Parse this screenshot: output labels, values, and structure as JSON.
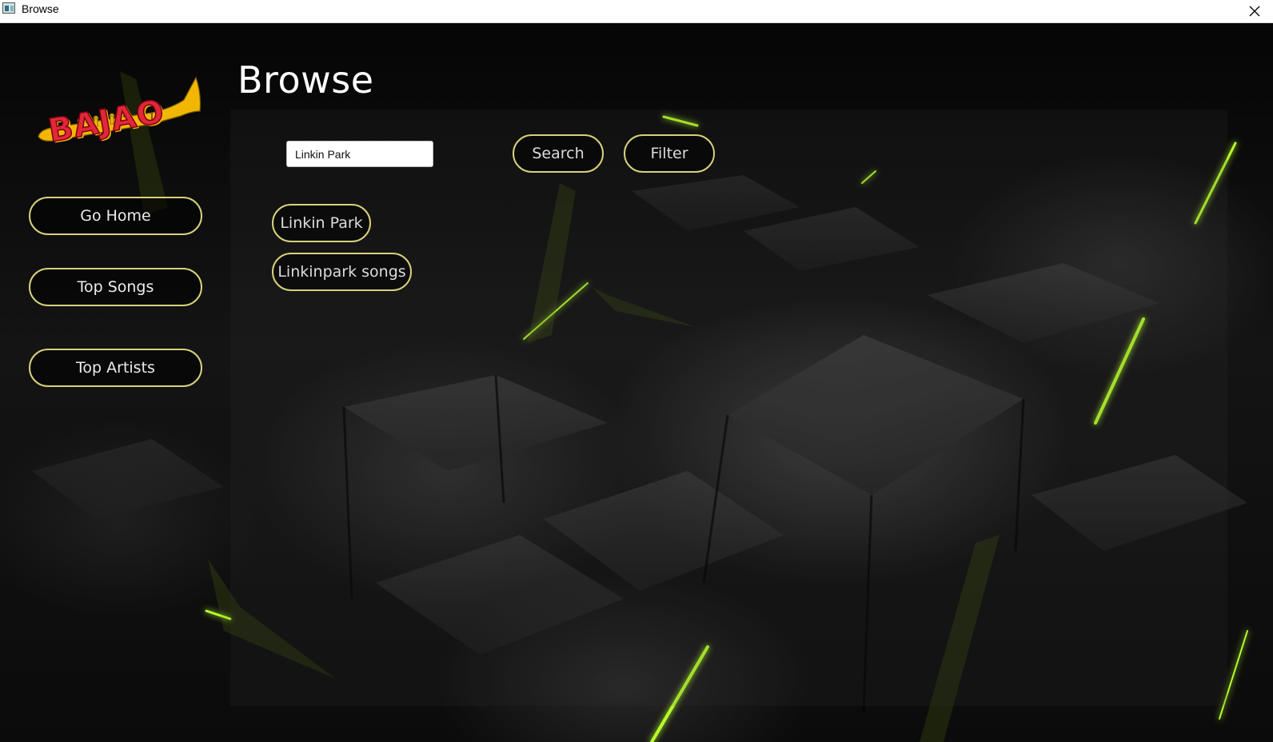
{
  "window": {
    "title": "Browse",
    "close_icon": "close-icon"
  },
  "logo": {
    "text": "BAJAO",
    "icon": "trumpet-icon"
  },
  "sidebar": {
    "items": [
      {
        "label": "Go Home"
      },
      {
        "label": "Top Songs"
      },
      {
        "label": "Top Artists"
      }
    ]
  },
  "page": {
    "title": "Browse"
  },
  "search": {
    "value": "Linkin Park",
    "button_label": "Search",
    "filter_label": "Filter"
  },
  "results": [
    {
      "label": "Linkin Park"
    },
    {
      "label": "Linkinpark songs"
    }
  ],
  "colors": {
    "button_border": "#d8d27a",
    "accent_green": "#b8ff2a",
    "logo_red": "#e0283a",
    "logo_gold": "#f2b705"
  }
}
